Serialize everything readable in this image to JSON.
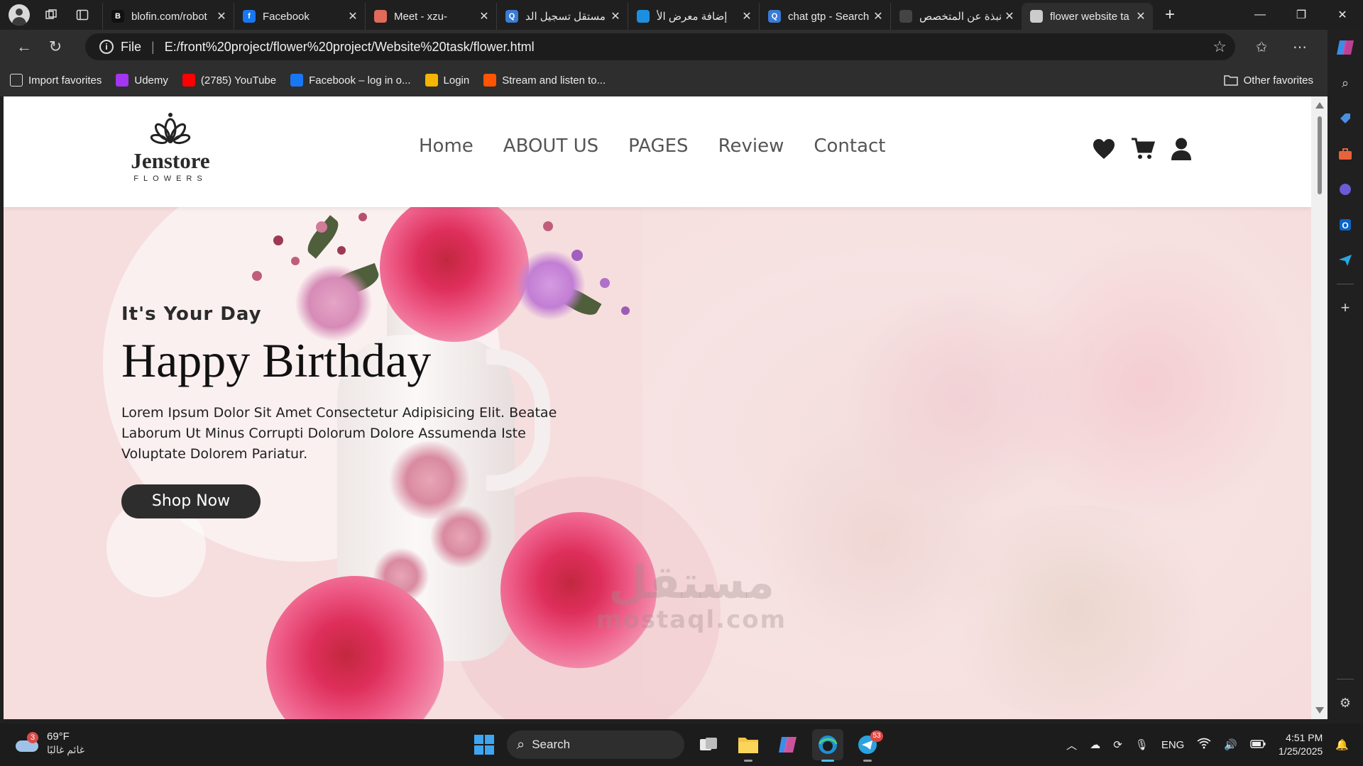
{
  "browser": {
    "tabs": [
      {
        "title": "blofin.com/robot",
        "icon": "blofin-icon",
        "color": "#111111",
        "glyph": "B"
      },
      {
        "title": "Facebook",
        "icon": "facebook-icon",
        "color": "#1877f2",
        "glyph": "f"
      },
      {
        "title": "Meet - xzu-",
        "icon": "meet-icon",
        "color": "#e06b5a",
        "glyph": ""
      },
      {
        "title": "مستقل تسجيل الد",
        "icon": "search-icon",
        "color": "#3a7bd5",
        "glyph": "Q"
      },
      {
        "title": "إضافة معرض الأ",
        "icon": "mostaql-icon",
        "color": "#1d8fe0",
        "glyph": ""
      },
      {
        "title": "chat gtp - Search",
        "icon": "search-icon",
        "color": "#3a7bd5",
        "glyph": "Q"
      },
      {
        "title": "نبذة عن المتخصص",
        "icon": "openai-icon",
        "color": "#444444",
        "glyph": ""
      },
      {
        "title": "flower website ta",
        "icon": "page-icon",
        "color": "#cccccc",
        "glyph": ""
      }
    ],
    "address": {
      "scheme_label": "File",
      "url": "E:/front%20project/flower%20project/Website%20task/flower.html"
    },
    "favorites": [
      {
        "label": "Import favorites",
        "icon": "import-icon",
        "color": "#2e2e2e"
      },
      {
        "label": "Udemy",
        "icon": "udemy-icon",
        "color": "#a435f0"
      },
      {
        "label": "(2785) YouTube",
        "icon": "youtube-icon",
        "color": "#ff0000"
      },
      {
        "label": "Facebook – log in o...",
        "icon": "facebook-icon",
        "color": "#1877f2"
      },
      {
        "label": "Login",
        "icon": "login-icon",
        "color": "#f4b400"
      },
      {
        "label": "Stream and listen to...",
        "icon": "soundcloud-icon",
        "color": "#ff5500"
      }
    ],
    "other_favorites": "Other favorites"
  },
  "site": {
    "logo": {
      "name": "Jenstore",
      "sub": "FLOWERS"
    },
    "nav": [
      "Home",
      "ABOUT US",
      "PAGES",
      "Review",
      "Contact"
    ],
    "hero": {
      "kicker": "It's Your Day",
      "title": "Happy Birthday",
      "description": "Lorem Ipsum Dolor Sit Amet Consectetur Adipisicing Elit. Beatae Laborum Ut Minus Corrupti Dolorum Dolore Assumenda Iste Voluptate Dolorem Pariatur.",
      "button": "Shop Now"
    },
    "colors": {
      "hero_bg": "#f6dede",
      "button_bg": "#2d2d2d",
      "rose": "#e53a6b"
    }
  },
  "watermark": {
    "arabic": "مستقل",
    "latin": "mostaql.com"
  },
  "taskbar": {
    "weather": {
      "temp": "69°F",
      "desc": "غائم غالبًا",
      "badge": "3"
    },
    "search_label": "Search",
    "telegram_badge": "53",
    "lang": "ENG",
    "time": "4:51 PM",
    "date": "1/25/2025"
  }
}
